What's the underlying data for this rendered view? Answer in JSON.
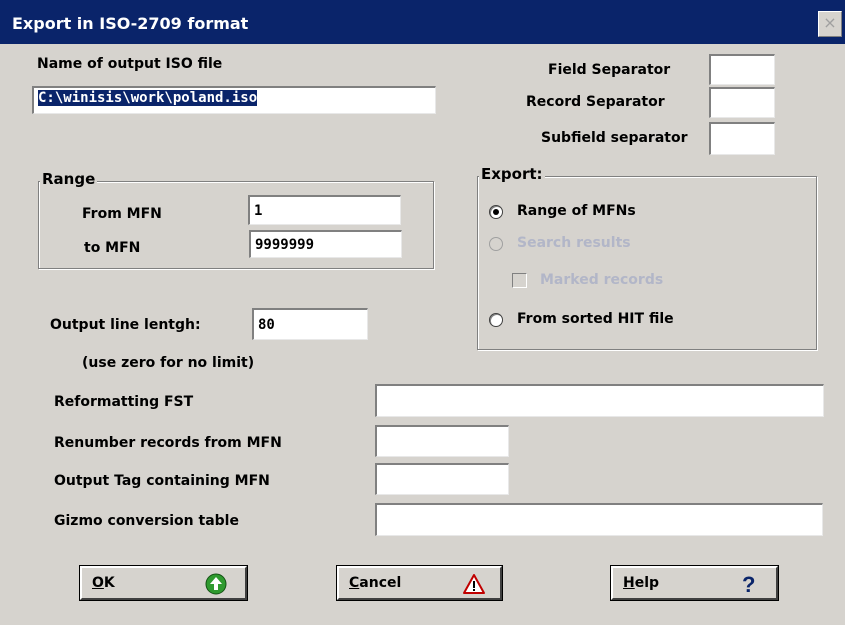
{
  "window": {
    "title": "Export in ISO-2709 format",
    "close_glyph": "×"
  },
  "output_file": {
    "label": "Name of output ISO file",
    "value": "C:\\winisis\\work\\poland.iso"
  },
  "separators": {
    "field_label": "Field Separator",
    "field_value": "",
    "record_label": "Record Separator",
    "record_value": "",
    "subfield_label": "Subfield separator",
    "subfield_value": ""
  },
  "range": {
    "legend": "Range",
    "from_label": "From MFN",
    "from_value": "1",
    "to_label": "to MFN",
    "to_value": "9999999"
  },
  "export": {
    "legend": "Export:",
    "options": [
      {
        "label": "Range of MFNs",
        "checked": true,
        "enabled": true
      },
      {
        "label": "Search results",
        "checked": false,
        "enabled": false
      },
      {
        "label": "From sorted HIT file",
        "checked": false,
        "enabled": true
      }
    ],
    "marked_records": {
      "label": "Marked records",
      "checked": false,
      "enabled": false
    }
  },
  "output_line": {
    "label": "Output line lentgh:",
    "value": "80",
    "hint": "(use zero for no limit)"
  },
  "reformatting_fst": {
    "label": "Reformatting FST",
    "value": ""
  },
  "renumber": {
    "label": "Renumber records from MFN",
    "value": ""
  },
  "output_tag": {
    "label": "Output Tag containing MFN",
    "value": ""
  },
  "gizmo": {
    "label": "Gizmo conversion table",
    "value": ""
  },
  "buttons": {
    "ok": {
      "label": "OK",
      "icon": "green-up-arrow-icon"
    },
    "cancel": {
      "label": "Cancel",
      "icon": "warning-triangle-icon"
    },
    "help": {
      "label": "Help",
      "icon": "question-mark-icon"
    }
  },
  "colors": {
    "titlebar": "#0a246a",
    "dialog": "#d6d3ce",
    "ok_icon": "#2f9a2f"
  }
}
